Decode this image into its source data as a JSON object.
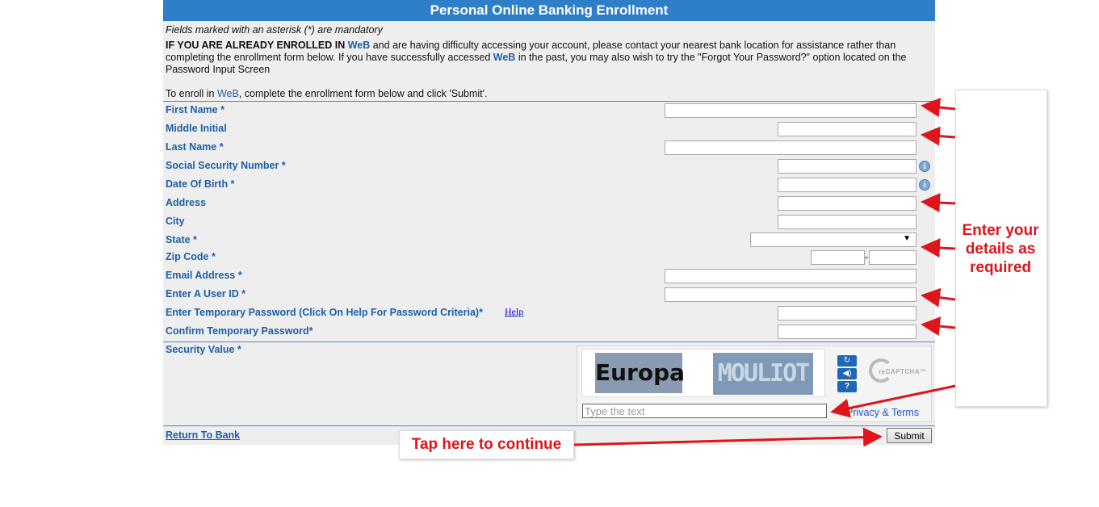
{
  "header": {
    "title": "Personal Online Banking Enrollment"
  },
  "intro": {
    "mandatory_note": "Fields marked with an asterisk (*) are mandatory",
    "already_enrolled_bold": "IF YOU ARE ALREADY ENROLLED IN",
    "brand": "WeB",
    "already_enrolled_rest1": "and are having difficulty accessing your account, please contact your nearest bank location for assistance rather than completing the enrollment form below. If you have successfully accessed",
    "already_enrolled_rest2": "in the past, you may also wish to try the \"Forgot Your Password?\" option located on the Password Input Screen",
    "enroll_prefix": "To enroll in",
    "enroll_suffix": ", complete the enrollment form below and click 'Submit'."
  },
  "form": {
    "first_name_label": "First Name *",
    "middle_initial_label": "Middle Initial",
    "last_name_label": "Last Name *",
    "ssn_label": "Social Security Number *",
    "dob_label": "Date Of Birth *",
    "address_label": "Address",
    "city_label": "City",
    "state_label": "State *",
    "state_value": "",
    "zip_label": "Zip Code *",
    "zip_separator": "-",
    "email_label": "Email Address *",
    "user_id_label": "Enter A User ID *",
    "temp_password_label": "Enter Temporary Password (Click On Help For Password Criteria)*",
    "help_link": "Help",
    "confirm_password_label": "Confirm Temporary Password*",
    "info_glyph": "i"
  },
  "captcha": {
    "label": "Security Value *",
    "word1": "Europa",
    "word2": "MOULIOT",
    "input_placeholder": "Type the text",
    "privacy_link": "Privacy & Terms",
    "recaptcha_brand": "reCAPTCHA™",
    "refresh_icon": "↻",
    "audio_icon": "◀)",
    "help_icon": "?"
  },
  "footer": {
    "return_link": "Return To Bank",
    "submit_label": "Submit"
  },
  "annotations": {
    "callout_text": "Enter your details as required",
    "continue_text": "Tap here to continue",
    "arrow_color": "#e0141b"
  },
  "colors": {
    "header_bg": "#2f7fc8",
    "label_color": "#1f5fa6",
    "panel_bg": "#eeeeee"
  }
}
